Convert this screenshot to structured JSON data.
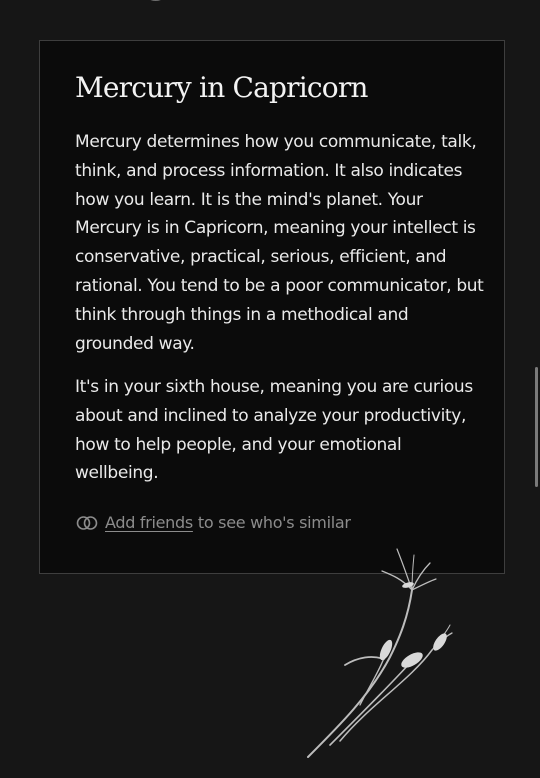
{
  "card": {
    "title": "Mercury in Capricorn",
    "paragraphs": [
      "Mercury determines how you communicate, talk, think, and process information. It also indicates how you learn. It is the mind's planet. Your Mercury is in Capricorn, meaning your intellect is conservative, practical, serious, efficient, and rational. You tend to be a poor communicator, but think through things in a methodical and grounded way.",
      "It's in your sixth house, meaning you are curious about and inclined to analyze your productivity, how to help people, and your emotional wellbeing."
    ],
    "friends": {
      "icon": "friends-rings-icon",
      "link_label": "Add friends",
      "suffix": "to see who's similar"
    }
  },
  "decorations": {
    "flower": "flower-illustration",
    "top_flower": "flower-fragment"
  },
  "colors": {
    "background": "#161616",
    "card_background": "#0b0b0b",
    "card_border": "#3e3e3e",
    "text": "#eaeaea",
    "muted_text": "#8c8c8c"
  }
}
